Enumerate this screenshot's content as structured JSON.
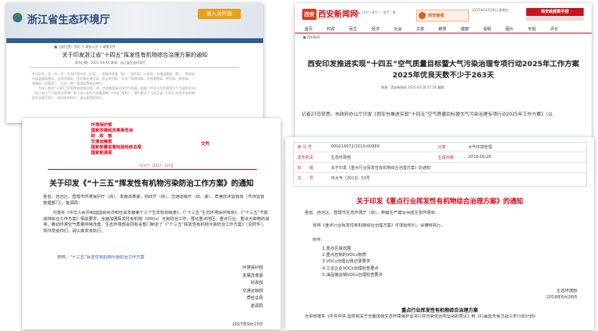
{
  "card1": {
    "site_name": "浙江省生态环境厅",
    "enter_button": "进入关怀版",
    "breadcrumb": "■ 当前位置：首页 > 政务公开 > 政策文件",
    "title": "关于印发浙江省“十四五”挥发性有机物综合治理方案的通知",
    "meta": "发布日期：2021-XX-XX  来源：浙江省生态环境厅",
    "body": [
      "各设区市、县（市、区）生态环境分局（分局）、发展改革委（局）、经信局、公安局、交通运输局（委）、商务局、",
      "市场监督管理局、自然资源局、住房城乡建设局、农业农村局、文化广电旅游局、应急管理局、林业局、税务局、",
      "海事局（交管局）、石化（港）管理局等有关单位：",
      "为深入推进“十四五”挥发性有机物治理，进一步改善我省环境空气质量，依据《中华人民共和国大气污染防治法》",
      "《浙江省大气污染防治条例》和《浙江省空气质量改善“十四五”规划》，我们制定了《浙江省“十四五”挥发性有机物",
      "综合治理方案》，现印发给你们，请认真贯彻执行。"
    ]
  },
  "card2": {
    "logo": "西安",
    "brand": "西安新闻网",
    "brand_sub": "www.xiancn.com",
    "weather": "☁ 23℃ / 8℃ ｜ 空气：良",
    "ad": "西安晚报",
    "date": "2025年03月28日 星期五",
    "tag": "西安晚报数字报",
    "nav": [
      "首页",
      "时政",
      "民生",
      "经济",
      "社会",
      "文旅",
      "教育",
      "健康",
      "视频",
      "图片",
      "专题",
      "评论"
    ],
    "breadcrumb": "■ 西安新闻",
    "title_line1": "西安印发推进实现“十四五”空气质量目标暨大气污染治理专项行动2025年工作方案",
    "title_line2": "2025年优良天数不少于263天",
    "meta": "来源：西安新闻网   2025-03-28 07:56   编辑：",
    "lead": "记者27日获悉，市政府办公厅印发《西安市推进实现“十四五”空气质量目标暨大气污染治理专项行动2025年工作方案》（以"
  },
  "card3": {
    "issuers": [
      "环境保护部",
      "国家发展和改革委员会",
      "财　政　部",
      "交通运输部",
      "国家质量监督检验检疫总局",
      "国家能源局"
    ],
    "doc_mark": "文件",
    "doc_no": "环大气〔2017〕121号",
    "title": "关于印发《“十三五”挥发性有机物污染防治工作方案》的通知",
    "recipients": "各省、自治区、直辖市环境保护厅（局）、发展改革委、财政厅（局）、交通运输厅（局、委）、质量技术监督局（市场监督管理部门），能源局：",
    "body": "为落实《中华人民共和国国民经济和社会发展第十三个五年规划纲要》、《“十三五”生态环境保护规划》、《“十三五”节能减排综合工作方案》相关要求，全面加强挥发性有机物（VOCs）污染防治工作，强化重点地区、重点行业、重点污染物的减排，推动环境空气质量持续改善，生态环境部会同有关部门制定了《“十三五”挥发性有机物污染防治工作方案》（见附件），现印发给你们，请认真贯彻执行。",
    "attachment_label": "附件：",
    "attachment_link": "“十三五”挥发性有机物污染防治工作方案",
    "signers": [
      "环境保护部",
      "发展改革委",
      "财政部",
      "交通运输部",
      "质检总局",
      "能源局"
    ],
    "date": "2017年9月13日"
  },
  "card4": {
    "rows": [
      {
        "label": "索 引 号",
        "value": "000014672/2019-00889",
        "label2": "分类",
        "value2": "大气环境管理"
      },
      {
        "label": "发布机关",
        "value": "生态环境部",
        "label2": "生成日期",
        "value2": "2019-06-26"
      },
      {
        "label": "标　　题",
        "value": "关于印发《重点行业挥发性有机物综合治理方案》的通知",
        "label2": "",
        "value2": ""
      },
      {
        "label": "文　　号",
        "value": "环大气〔2019〕53号",
        "label2": "",
        "value2": ""
      }
    ],
    "title": "关于印发《重点行业挥发性有机物综合治理方案》的通知",
    "recipients": "各省、自治区、直辖市生态环境厅（局），新疆生产建设兵团生态环境局：",
    "para": "现将《重点行业挥发性有机物综合治理方案》印发给你们，请遵照执行。",
    "attachment_label": "附件：",
    "attachments": [
      "1.重点区域范围",
      "2.重点控制的VOCs物质",
      "3.VOCs治理台账记录要求",
      "4.工业企业VOCs治理检查要点",
      "5.油品储运销VOCs治理检查要点"
    ],
    "signer": "生态环境部",
    "date": "2019年6月26日",
    "subtitle": "重点行业挥发性有机物综合治理方案",
    "last": "为贯彻落实《中共中央 国务院关于全面加强生态环境保护坚决打好污染防治攻坚战的意见》和《打赢蓝天保卫战三年行动计划》"
  }
}
